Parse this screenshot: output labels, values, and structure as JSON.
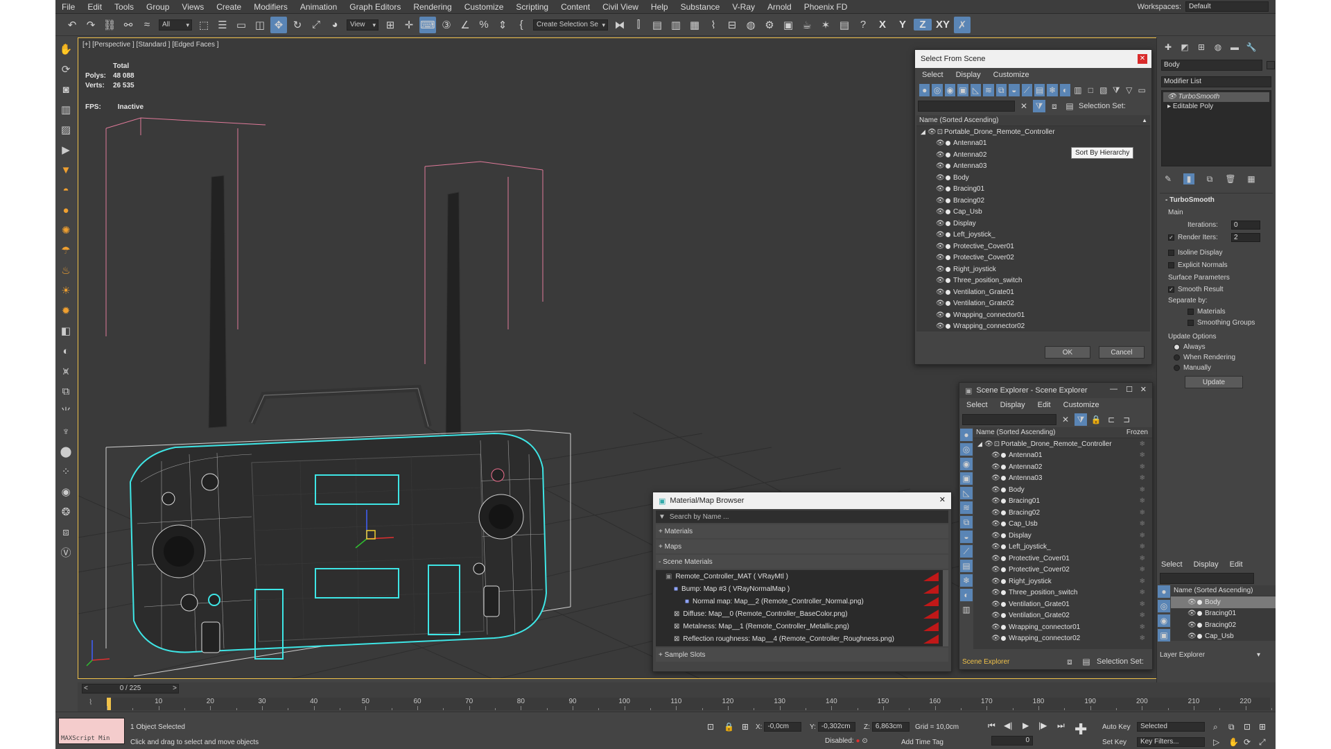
{
  "menu": [
    "File",
    "Edit",
    "Tools",
    "Group",
    "Views",
    "Create",
    "Modifiers",
    "Animation",
    "Graph Editors",
    "Rendering",
    "Customize",
    "Scripting",
    "Content",
    "Civil View",
    "Help",
    "Substance",
    "V-Ray",
    "Arnold",
    "Phoenix FD"
  ],
  "workspace": {
    "label": "Workspaces:",
    "value": "Default"
  },
  "toolbar": {
    "filter": "All",
    "view": "View",
    "selection_set": "Create Selection Se",
    "axes": [
      "X",
      "Y",
      "Z",
      "XY"
    ]
  },
  "viewport": {
    "label": "[+] [Perspective ] [Standard ] [Edged Faces ]",
    "stats": {
      "total": "Total",
      "polys_label": "Polys:",
      "polys": "48 088",
      "verts_label": "Verts:",
      "verts": "26 535"
    },
    "fps_label": "FPS:",
    "fps": "Inactive"
  },
  "select_from_scene": {
    "title": "Select From Scene",
    "menu": [
      "Select",
      "Display",
      "Customize"
    ],
    "selection_set_label": "Selection Set:",
    "tooltip": "Sort By Hierarchy",
    "header": "Name (Sorted Ascending)",
    "root": "Portable_Drone_Remote_Controller",
    "items": [
      "Antenna01",
      "Antenna02",
      "Antenna03",
      "Body",
      "Bracing01",
      "Bracing02",
      "Cap_Usb",
      "Display",
      "Left_joystick_",
      "Protective_Cover01",
      "Protective_Cover02",
      "Right_joystick",
      "Three_position_switch",
      "Ventilation_Grate01",
      "Ventilation_Grate02",
      "Wrapping_connector01",
      "Wrapping_connector02"
    ],
    "ok": "OK",
    "cancel": "Cancel"
  },
  "scene_explorer": {
    "title": "Scene Explorer - Scene Explorer",
    "menu": [
      "Select",
      "Display",
      "Edit",
      "Customize"
    ],
    "header": "Name (Sorted Ascending)",
    "frozen": "Frozen",
    "root": "Portable_Drone_Remote_Controller",
    "items": [
      "Antenna01",
      "Antenna02",
      "Antenna03",
      "Body",
      "Bracing01",
      "Bracing02",
      "Cap_Usb",
      "Display",
      "Left_joystick_",
      "Protective_Cover01",
      "Protective_Cover02",
      "Right_joystick",
      "Three_position_switch",
      "Ventilation_Grate01",
      "Ventilation_Grate02",
      "Wrapping_connector01",
      "Wrapping_connector02"
    ],
    "footer": "Scene Explorer",
    "selection_set_label": "Selection Set:"
  },
  "material_browser": {
    "title": "Material/Map Browser",
    "search": "Search by Name ...",
    "sections": [
      "+ Materials",
      "+ Maps",
      "- Scene Materials"
    ],
    "tree": [
      "Remote_Controller_MAT ( VRayMtl )",
      "Bump: Map #3  ( VRayNormalMap )",
      "Normal map: Map__2 (Remote_Controller_Normal.png)",
      "Diffuse: Map__0 (Remote_Controller_BaseColor.png)",
      "Metalness: Map__1 (Remote_Controller_Metallic.png)",
      "Reflection roughness: Map__4 (Remote_Controller_Roughness.png)"
    ],
    "sample_slots": "+ Sample Slots"
  },
  "command_panel": {
    "object_name": "Body",
    "modifier_list": "Modifier List",
    "stack": [
      "TurboSmooth",
      "Editable Poly"
    ],
    "turbosmooth": {
      "title": "TurboSmooth",
      "main": "Main",
      "iterations_label": "Iterations:",
      "iterations": "0",
      "render_iters_label": "Render Iters:",
      "render_iters": "2",
      "isoline": "Isoline Display",
      "explicit": "Explicit Normals",
      "surface": "Surface Parameters",
      "smooth_result": "Smooth Result",
      "separate_by": "Separate by:",
      "materials": "Materials",
      "smoothing_groups": "Smoothing Groups",
      "update_options": "Update Options",
      "always": "Always",
      "when_rendering": "When Rendering",
      "manually": "Manually",
      "update": "Update"
    }
  },
  "layer_explorer": {
    "menu": [
      "Select",
      "Display",
      "Edit"
    ],
    "header": "Name (Sorted Ascending)",
    "items": [
      "Body",
      "Bracing01",
      "Bracing02",
      "Cap_Usb"
    ],
    "footer": "Layer Explorer"
  },
  "timeline": {
    "slider": "0 / 225",
    "ticks": [
      "10",
      "20",
      "30",
      "40",
      "50",
      "60",
      "70",
      "80",
      "90",
      "100",
      "110",
      "120",
      "130",
      "140",
      "150",
      "160",
      "170",
      "180",
      "190",
      "200",
      "210",
      "220"
    ]
  },
  "status": {
    "maxscript": "MAXScript Min",
    "selected": "1 Object Selected",
    "hint": "Click and drag to select and move objects",
    "x_label": "X:",
    "x": "-0,0cm",
    "y_label": "Y:",
    "y": "-0,302cm",
    "z_label": "Z:",
    "z": "6,863cm",
    "grid": "Grid = 10,0cm",
    "disabled": "Disabled:",
    "add_time_tag": "Add Time Tag",
    "auto_key": "Auto Key",
    "set_key": "Set Key",
    "selected_dd": "Selected",
    "key_filters": "Key Filters...",
    "frame": "0"
  }
}
